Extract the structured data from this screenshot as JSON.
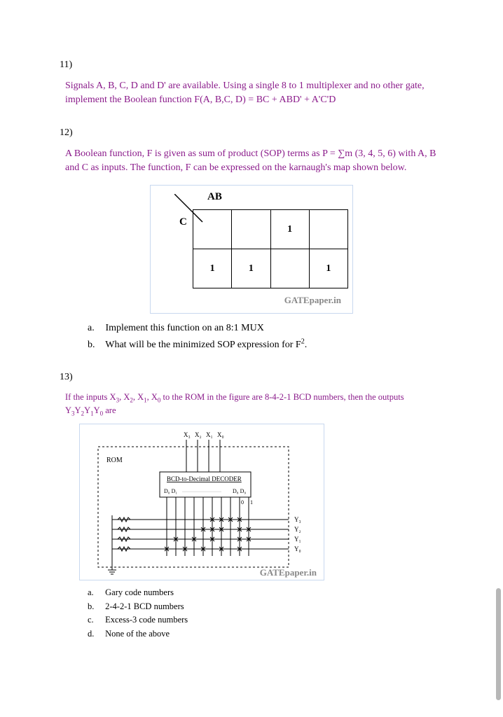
{
  "q11": {
    "num": "11)",
    "text": "Signals A, B, C, D and D' are available. Using a single 8 to 1 multiplexer and no other gate, implement the Boolean function F(A, B,C, D) = BC + ABD' + A'C'D"
  },
  "q12": {
    "num": "12)",
    "text": "A Boolean function, F is given as sum of product (SOP) terms as P = ∑m (3, 4, 5, 6) with A, B and C as inputs. The function, F can be expressed on the karnaugh's map shown below.",
    "kmap": {
      "ab_label": "AB",
      "c_label": "C",
      "rows": [
        [
          "",
          "",
          "1",
          ""
        ],
        [
          "1",
          "1",
          "",
          "1"
        ]
      ],
      "watermark": "GATEpaper.in"
    },
    "parts": {
      "a": {
        "label": "a.",
        "text": "Implement this function on an 8:1 MUX"
      },
      "b": {
        "label": "b.",
        "text_prefix": "What will be the minimized SOP expression for F",
        "sup": "2",
        "text_suffix": "."
      }
    }
  },
  "q13": {
    "num": "13)",
    "intro_prefix": "If the inputs X",
    "x3": "3",
    "x2": "2",
    "x1": "1",
    "x0": "0",
    "intro_mid": " to the ROM in the figure are 8-4-2-1 BCD numbers, then the outputs Y",
    "y3": "3",
    "y2": "2",
    "y1": "1",
    "y0": "0",
    "intro_suffix": " are",
    "diagram": {
      "inputs": [
        "X₃",
        "X₂",
        "X₁",
        "X₀"
      ],
      "rom_label": "ROM",
      "decoder_label": "BCD-to-Decimal DECODER",
      "d_left": "D₀ D₁",
      "d_right": "D₈ D₉",
      "bits": [
        "0",
        "1"
      ],
      "outputs": [
        "Y₃",
        "Y₂",
        "Y₁",
        "Y₀"
      ],
      "watermark": "GATEpaper.in"
    },
    "options": {
      "a": {
        "label": "a.",
        "text": "Gary code numbers"
      },
      "b": {
        "label": "b.",
        "text": "2-4-2-1 BCD numbers"
      },
      "c": {
        "label": "c.",
        "text": "Excess-3 code numbers"
      },
      "d": {
        "label": "d.",
        "text": "None of the above"
      }
    }
  }
}
